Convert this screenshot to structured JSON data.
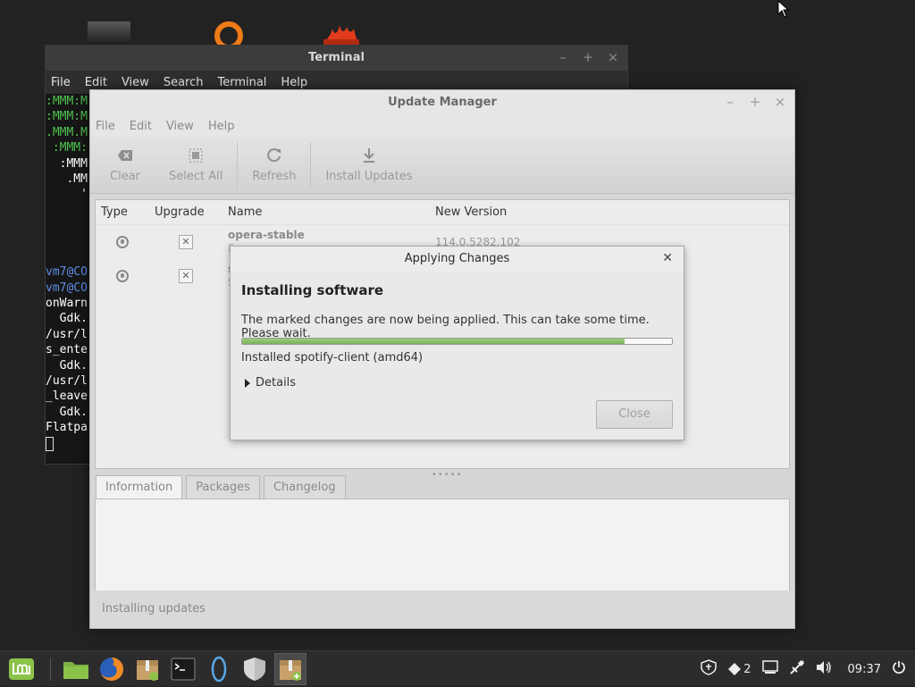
{
  "terminal": {
    "title": "Terminal",
    "menu": [
      "File",
      "Edit",
      "View",
      "Search",
      "Terminal",
      "Help"
    ],
    "lines": [
      {
        "text": ":MMM:M",
        "color": "green"
      },
      {
        "text": ":MMM:M",
        "color": "green"
      },
      {
        "text": ".MMM.M",
        "color": "green"
      },
      {
        "text": " :MMM:",
        "color": "green"
      },
      {
        "text": "  :MMM",
        "color": "white"
      },
      {
        "text": "   .MM",
        "color": "white"
      },
      {
        "text": "     '",
        "color": "white"
      },
      {
        "text": "",
        "color": "white"
      },
      {
        "text": "",
        "color": "white"
      },
      {
        "text": "",
        "color": "white"
      },
      {
        "text": "",
        "color": "white"
      },
      {
        "text": "vm7@CO",
        "color": "blue"
      },
      {
        "text": "vm7@CO",
        "color": "blue"
      },
      {
        "text": "onWarn",
        "color": "white"
      },
      {
        "text": "  Gdk.",
        "color": "white"
      },
      {
        "text": "/usr/l",
        "color": "white"
      },
      {
        "text": "s_ente",
        "color": "white"
      },
      {
        "text": "  Gdk.",
        "color": "white"
      },
      {
        "text": "/usr/l",
        "color": "white"
      },
      {
        "text": "_leave",
        "color": "white"
      },
      {
        "text": "  Gdk.",
        "color": "white"
      },
      {
        "text": "Flatpa",
        "color": "white"
      }
    ]
  },
  "update_manager": {
    "title": "Update Manager",
    "menu": [
      "File",
      "Edit",
      "View",
      "Help"
    ],
    "toolbar": {
      "clear": "Clear",
      "select_all": "Select All",
      "refresh": "Refresh",
      "install": "Install Updates"
    },
    "columns": {
      "type": "Type",
      "upgrade": "Upgrade",
      "name": "Name",
      "version": "New Version"
    },
    "rows": [
      {
        "name": "opera-stable",
        "sub": "F",
        "version": "114.0.5282.102"
      },
      {
        "name": "s",
        "sub": "S",
        "version": ""
      }
    ],
    "tabs": [
      "Information",
      "Packages",
      "Changelog"
    ],
    "status": "Installing updates"
  },
  "dialog": {
    "title": "Applying Changes",
    "heading": "Installing software",
    "message": "The marked changes are now being applied. This can take some time. Please wait.",
    "progress_fraction": 0.89,
    "status": "Installed spotify-client (amd64)",
    "details": "Details",
    "close_button": "Close"
  },
  "taskbar": {
    "apps": [
      "mint-menu-icon",
      "files-icon",
      "firefox-icon",
      "package-installer-icon",
      "terminal-icon",
      "opera-icon",
      "shield-icon",
      "update-manager-icon"
    ],
    "tray_badge": "2",
    "clock": "09:37"
  }
}
